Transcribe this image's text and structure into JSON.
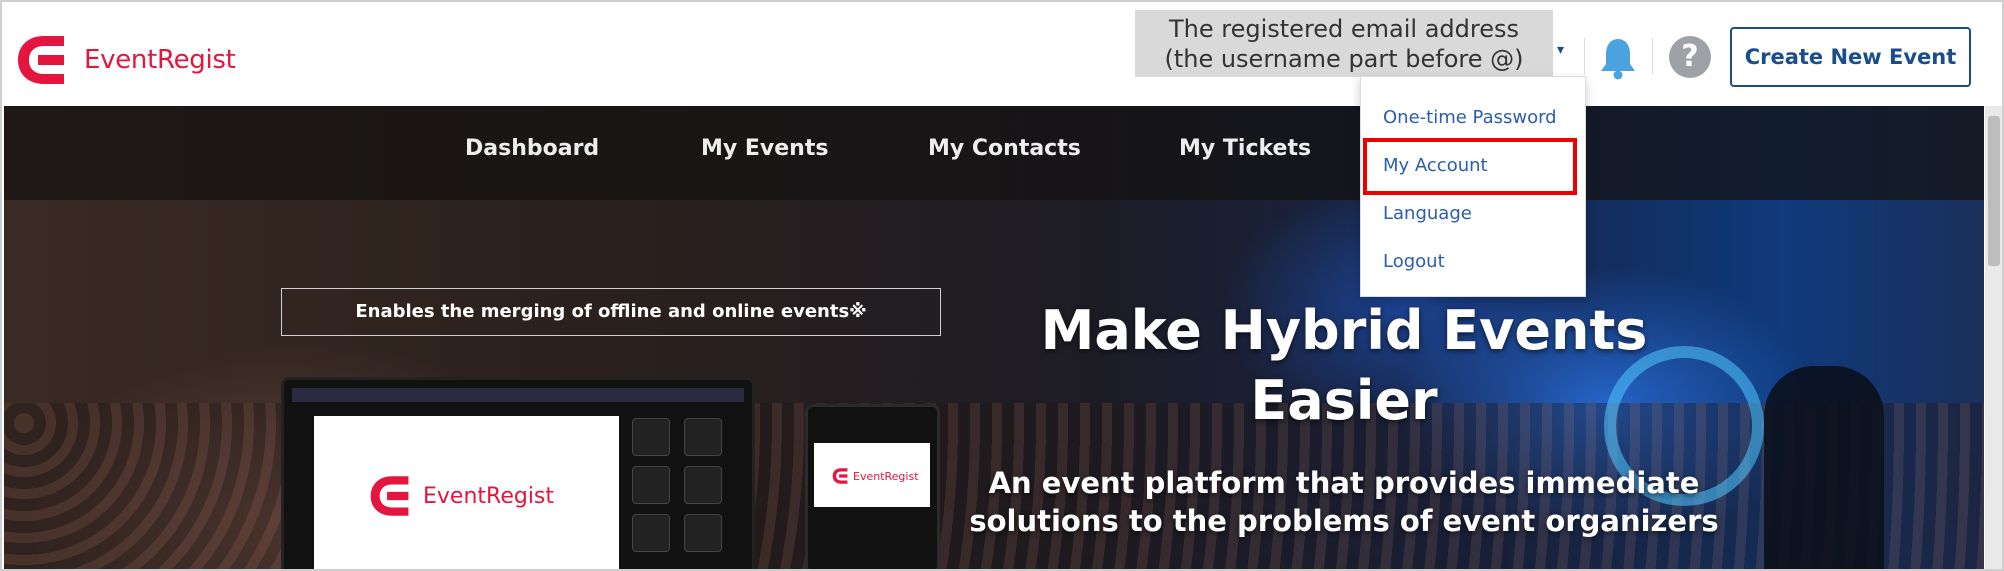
{
  "brand": {
    "name": "EventRegist",
    "color": "#e4163f"
  },
  "header": {
    "tooltip_line1": "The registered email address",
    "tooltip_line2": "(the username part before @)",
    "user_menu_caret": "▾",
    "bell_icon": "bell-icon",
    "help_icon": "question-icon",
    "help_glyph": "?",
    "create_button": "Create New Event",
    "accent_color": "#1a4d8c"
  },
  "nav": {
    "items": [
      "Dashboard",
      "My Events",
      "My Contacts",
      "My Tickets"
    ]
  },
  "dropdown": {
    "items": [
      "One-time Password",
      "My Account",
      "Language",
      "Logout"
    ],
    "highlighted": "My Account",
    "highlight_color": "#ee0000"
  },
  "hero": {
    "merge_text": "Enables the merging of offline and online events※",
    "title_line1": "Make Hybrid Events",
    "title_line2": "Easier",
    "subtitle_line1": "An event platform that provides immediate",
    "subtitle_line2": "solutions to the problems of event organizers"
  }
}
